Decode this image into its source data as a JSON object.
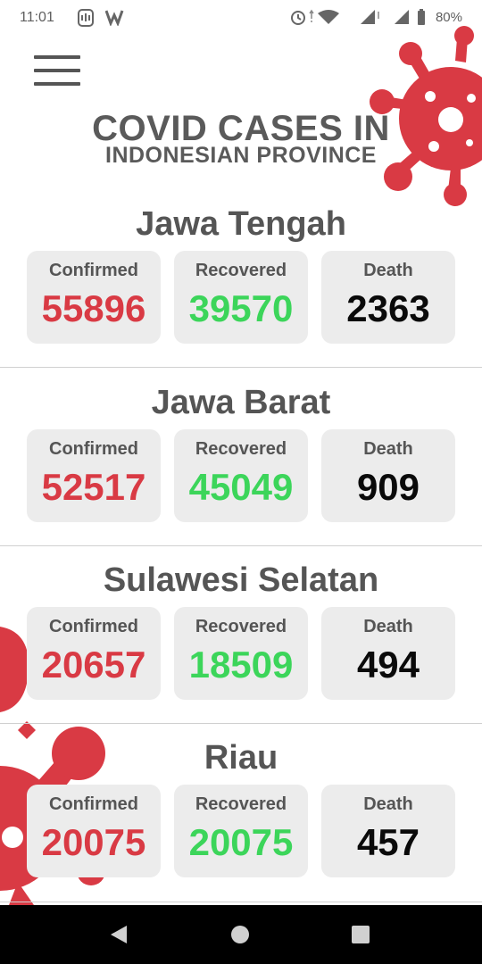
{
  "status_bar": {
    "time": "11:01",
    "battery": "80%"
  },
  "header": {
    "title": "COVID CASES IN",
    "subtitle": "INDONESIAN PROVINCE"
  },
  "colors": {
    "confirmed": "#d93a44",
    "recovered": "#3cd55a",
    "death": "#0a0a0a",
    "virus": "#d93a44"
  },
  "provinces": [
    {
      "name": "Jawa Tengah",
      "confirmed_label": "Confirmed",
      "confirmed": "55896",
      "recovered_label": "Recovered",
      "recovered": "39570",
      "death_label": "Death",
      "death": "2363"
    },
    {
      "name": "Jawa Barat",
      "confirmed_label": "Confirmed",
      "confirmed": "52517",
      "recovered_label": "Recovered",
      "recovered": "45049",
      "death_label": "Death",
      "death": "909"
    },
    {
      "name": "Sulawesi Selatan",
      "confirmed_label": "Confirmed",
      "confirmed": "20657",
      "recovered_label": "Recovered",
      "recovered": "18509",
      "death_label": "Death",
      "death": "494"
    },
    {
      "name": "Riau",
      "confirmed_label": "Confirmed",
      "confirmed": "20075",
      "recovered_label": "Recovered",
      "recovered": "20075",
      "death_label": "Death",
      "death": "457"
    }
  ],
  "icons": [
    "menu-icon",
    "alarm-icon",
    "wifi-icon",
    "signal-icon",
    "battery-icon",
    "virus-icon",
    "back-icon",
    "home-icon",
    "recents-icon"
  ]
}
